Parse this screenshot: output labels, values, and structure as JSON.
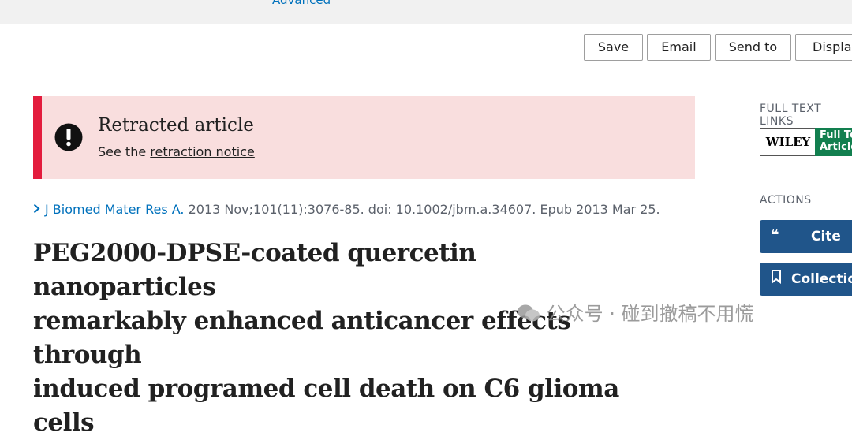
{
  "topbar": {
    "advanced_link": "Advanced"
  },
  "toolbar": {
    "save": "Save",
    "email": "Email",
    "send_to": "Send to",
    "display": "Display"
  },
  "retraction": {
    "title": "Retracted article",
    "prefix": "See the ",
    "link": "retraction notice"
  },
  "citation": {
    "journal": "J Biomed Mater Res A.",
    "details": " 2013 Nov;101(11):3076-85. doi: 10.1002/jbm.a.34607. Epub 2013 Mar 25."
  },
  "article": {
    "title_line1": "PEG2000-DPSE-coated quercetin nanoparticles",
    "title_line2": "remarkably enhanced anticancer effects through",
    "title_line3": "induced programed cell death on C6 glioma cells"
  },
  "sidebar": {
    "full_text_label": "FULL TEXT LINKS",
    "wiley_logo": "WILEY",
    "full_text_line1": "Full Text",
    "full_text_line2": "Article",
    "actions_label": "ACTIONS",
    "cite": "Cite",
    "collections": "Collections"
  },
  "watermark": {
    "text": "公众号 · 碰到撤稿不用慌"
  },
  "colors": {
    "accent": "#0071bc",
    "retraction_bar": "#e31c3d",
    "banner_bg": "#f9dede",
    "action_button": "#20558a",
    "wiley_green": "#127f4f"
  }
}
